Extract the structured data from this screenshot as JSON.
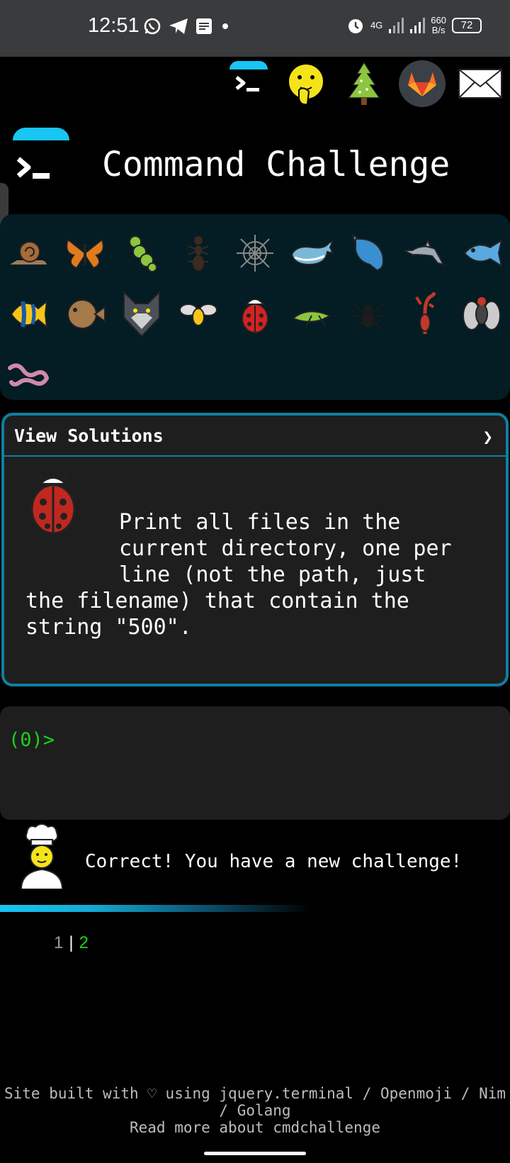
{
  "status_bar": {
    "time": "12:51",
    "network_type": "4G",
    "speed_value": "660",
    "speed_unit": "B/s",
    "battery": "72",
    "icons_left": [
      "whatsapp-icon",
      "telegram-icon",
      "notes-icon",
      "dot-icon"
    ],
    "icons_right": [
      "alarm-icon",
      "signal-icon",
      "signal-icon"
    ]
  },
  "header": {
    "icons": [
      "terminal-icon",
      "shushing-face-icon",
      "tree-icon",
      "gitlab-icon",
      "mail-icon"
    ],
    "title": "Command Challenge"
  },
  "emoji_grid": {
    "rows": [
      [
        "snail-icon",
        "butterfly-icon",
        "caterpillar-icon",
        "ant-icon",
        "spider-web-icon",
        "whale-icon",
        "whale2-icon",
        "dolphin-icon",
        "fish-icon"
      ],
      [
        "tropical-fish-icon",
        "blowfish-icon",
        "wolf-icon",
        "bee-icon",
        "ladybug-icon",
        "cricket-icon",
        "spider-icon",
        "scorpion-icon",
        "fly-icon"
      ],
      [
        "worm-icon"
      ]
    ]
  },
  "solutions": {
    "label": "View Solutions",
    "chevron": "❯",
    "challenge_line1": "Print all files in the",
    "challenge_line2": "current directory, one per",
    "challenge_line3": "line (not the path, just",
    "challenge_line4": "the filename) that contain the",
    "challenge_line5": "string \"500\"."
  },
  "terminal": {
    "prompt": "(0)>"
  },
  "feedback": {
    "message": "Correct! You have a new challenge!"
  },
  "pager": {
    "page_previous": "1",
    "separator": "|",
    "page_current": "2"
  },
  "footer": {
    "line1": "Site built with ♡ using jquery.terminal / Openmoji / Nim",
    "line2": "/ Golang",
    "line3": "Read more about cmdchallenge"
  },
  "colors": {
    "accent": "#19c5f2",
    "prompt_green": "#19d219",
    "card_border": "#0f7fa0"
  }
}
